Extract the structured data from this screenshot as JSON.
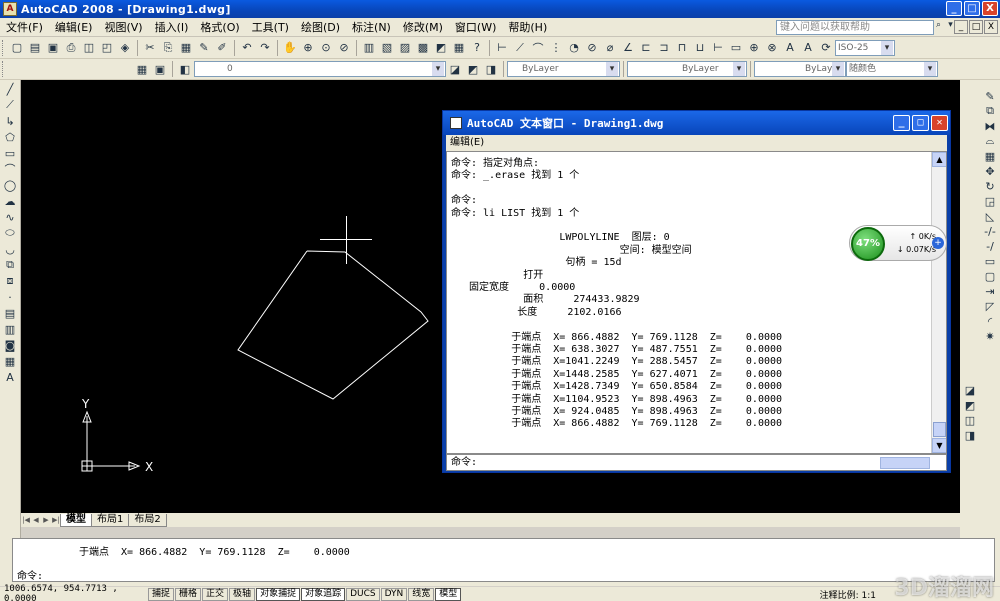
{
  "window": {
    "title": "AutoCAD 2008 - [Drawing1.dwg]",
    "icon_text": "A",
    "controls": [
      "_",
      "□",
      "X"
    ]
  },
  "menubar": {
    "items": [
      "文件(F)",
      "编辑(E)",
      "视图(V)",
      "插入(I)",
      "格式(O)",
      "工具(T)",
      "绘图(D)",
      "标注(N)",
      "修改(M)",
      "窗口(W)",
      "帮助(H)"
    ],
    "help_placeholder": "键入问题以获取帮助",
    "doc_controls": [
      "_",
      "□",
      "X"
    ]
  },
  "toolbar2": {
    "layer_value": "0",
    "linetype_by": "ByLayer",
    "lineweight_by": "ByLayer",
    "plotstyle": "随颜色",
    "dimstyle": "ISO-25"
  },
  "textwindow": {
    "title": "AutoCAD 文本窗口 - Drawing1.dwg",
    "menu": "编辑(E)",
    "lines": [
      "命令: 指定对角点:",
      "命令: _.erase 找到 1 个",
      "",
      "命令:",
      "命令: li LIST 找到 1 个",
      "",
      "                  LWPOLYLINE  图层: 0",
      "                            空间: 模型空间",
      "                   句柄 = 15d",
      "            打开",
      "   固定宽度     0.0000",
      "            面积     274433.9829",
      "           长度     2102.0166",
      "",
      "          于端点  X= 866.4882  Y= 769.1128  Z=    0.0000",
      "          于端点  X= 638.3027  Y= 487.7551  Z=    0.0000",
      "          于端点  X=1041.2249  Y= 288.5457  Z=    0.0000",
      "          于端点  X=1448.2585  Y= 627.4071  Z=    0.0000",
      "          于端点  X=1428.7349  Y= 650.8584  Z=    0.0000",
      "          于端点  X=1104.9523  Y= 898.4963  Z=    0.0000",
      "          于端点  X= 924.0485  Y= 898.4963  Z=    0.0000",
      "          于端点  X= 866.4882  Y= 769.1128  Z=    0.0000"
    ],
    "prompt": "命令:"
  },
  "network": {
    "percent": "47%",
    "up": "0K/s",
    "down": "0.07K/s"
  },
  "layout_tabs": [
    "模型",
    "布局1",
    "布局2"
  ],
  "ucs": {
    "x": "X",
    "y": "Y"
  },
  "command_line": {
    "history": "于端点  X= 866.4882  Y= 769.1128  Z=    0.0000",
    "prompt": "命令:"
  },
  "statusbar": {
    "coords": "1006.6574, 954.7713 , 0.0000",
    "toggles": [
      "捕捉",
      "栅格",
      "正交",
      "极轴",
      "对象捕捉",
      "对象追踪",
      "DUCS",
      "DYN",
      "线宽",
      "模型"
    ],
    "annotation_scale": "注释比例: 1:1",
    "watermark": "3D溜溜网"
  }
}
